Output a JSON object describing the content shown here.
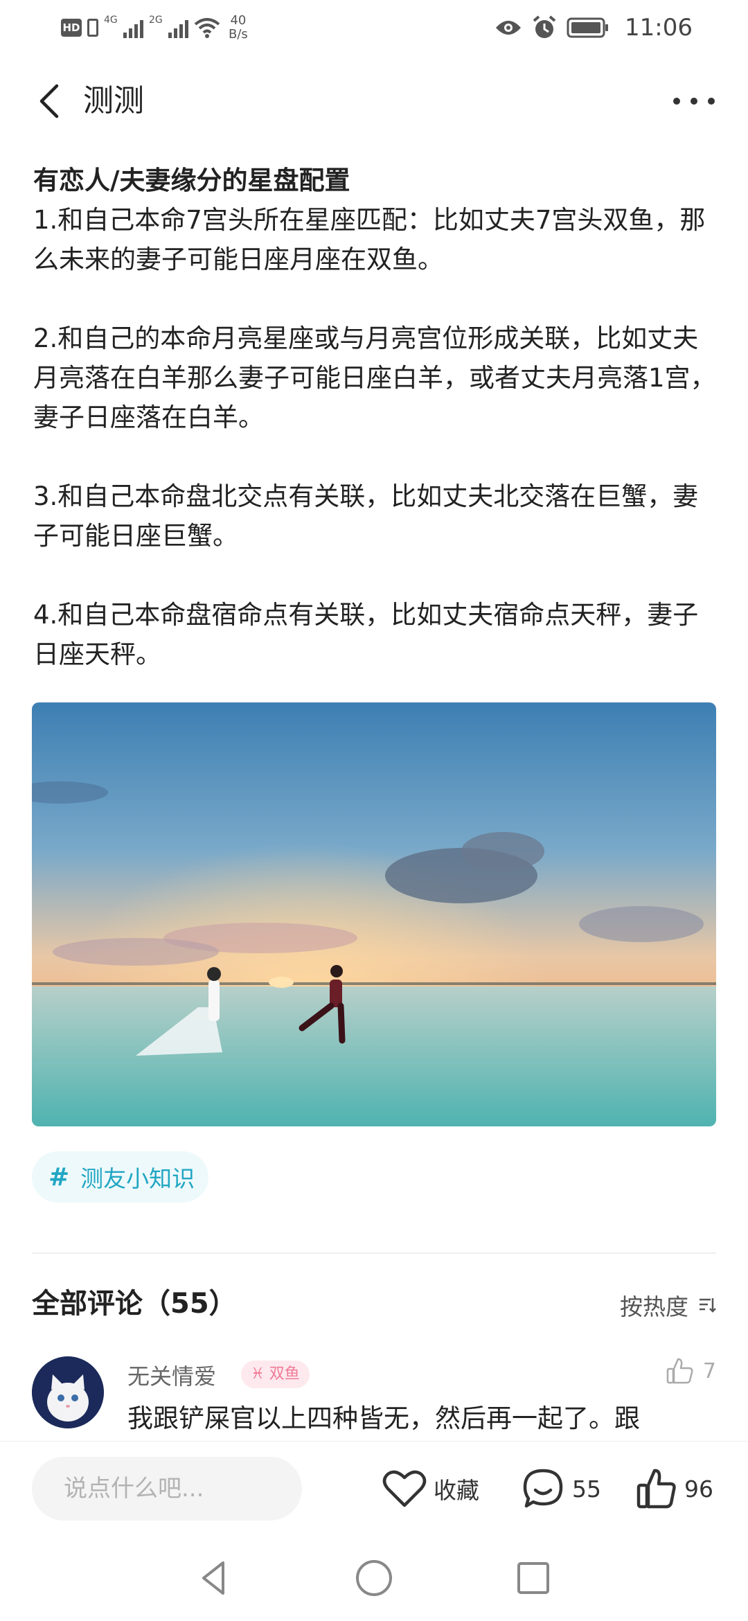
{
  "status_bar": {
    "hd": "HD",
    "sim1_type": "4G",
    "sim2_type": "2G",
    "net_speed_value": "40",
    "net_speed_unit": "B/s",
    "time": "11:06",
    "icons": [
      "hd-icon",
      "sim-icon",
      "signal-icon",
      "wifi-icon",
      "eye-icon",
      "alarm-icon",
      "battery-icon"
    ]
  },
  "nav": {
    "title": "测测",
    "back_icon": "chevron-left-icon",
    "more_icon": "more-dots-icon"
  },
  "article": {
    "heading": "有恋人/夫妻缘分的星盘配置",
    "paragraphs": [
      "1.和自己本命7宫头所在星座匹配：比如丈夫7宫头双鱼，那么未来的妻子可能日座月座在双鱼。",
      "2.和自己的本命月亮星座或与月亮宫位形成关联，比如丈夫月亮落在白羊那么妻子可能日座白羊，或者丈夫月亮落1宫，妻子日座落在白羊。",
      "3.和自己本命盘北交点有关联，比如丈夫北交落在巨蟹，妻子可能日座巨蟹。",
      "4.和自己本命盘宿命点有关联，比如丈夫宿命点天秤，妻子日座天秤。"
    ]
  },
  "topic": {
    "hash": "#",
    "label": "测友小知识"
  },
  "comments": {
    "title": "全部评论（55）",
    "sort_label": "按热度",
    "items": [
      {
        "username": "无关情爱",
        "zodiac": "♓ 双鱼",
        "likes": "7",
        "text": "我跟铲屎官以上四种皆无，然后再一起了。跟"
      }
    ]
  },
  "action_bar": {
    "input_placeholder": "说点什么吧...",
    "favorite_label": "收藏",
    "comment_count": "55",
    "like_count": "96"
  },
  "colors": {
    "accent": "#21a6c3",
    "topic_bg": "#eef9fb",
    "zodiac_badge_bg": "#fde9ee",
    "zodiac_badge_text": "#f07a95"
  }
}
